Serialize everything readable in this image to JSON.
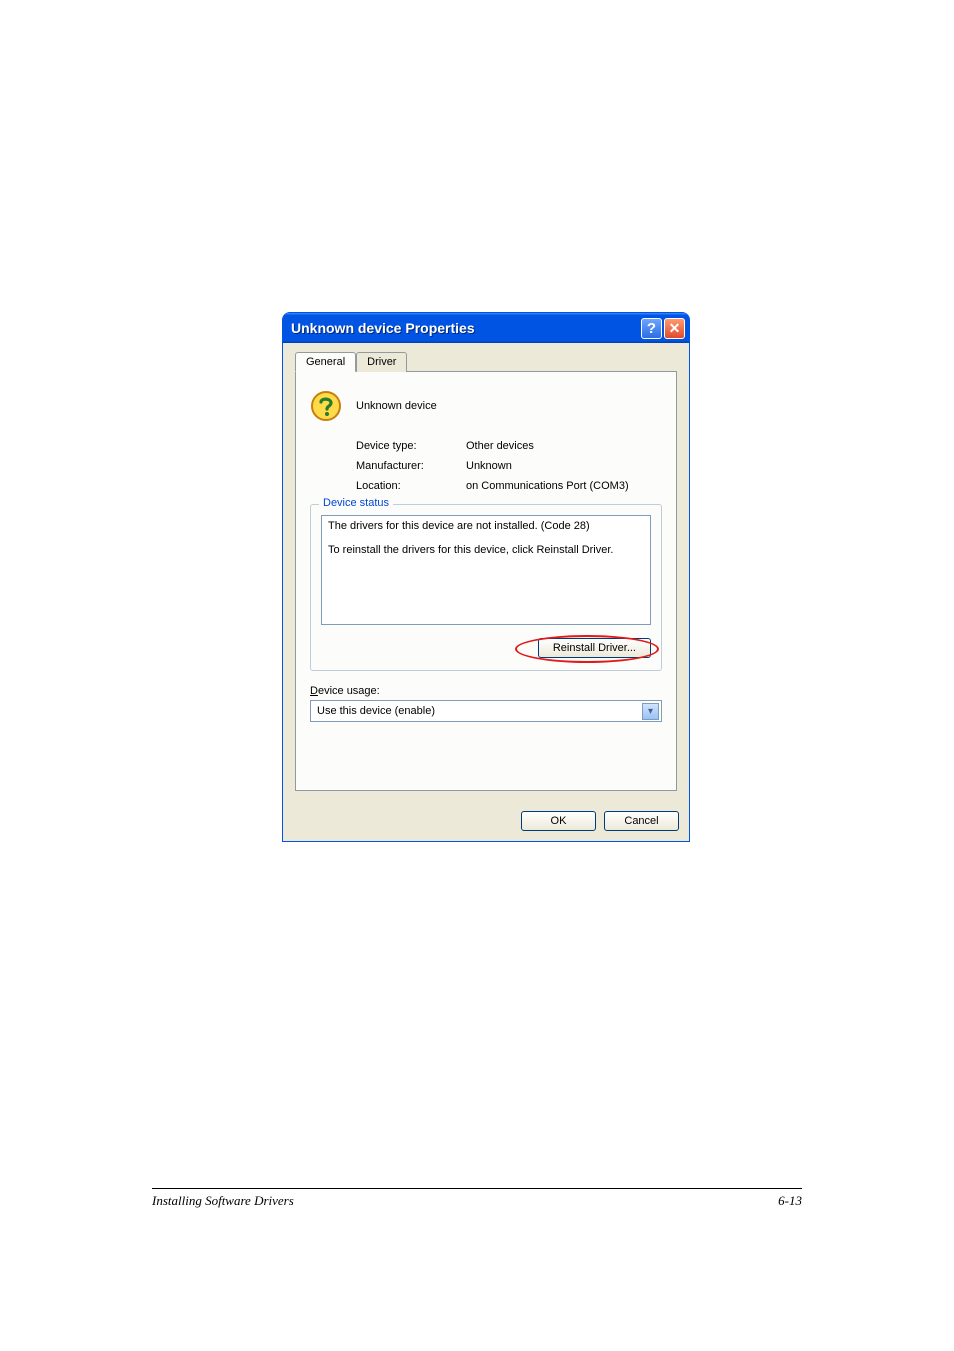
{
  "dialog": {
    "title": "Unknown device Properties",
    "tabs": {
      "general": "General",
      "driver": "Driver"
    },
    "device_name": "Unknown device",
    "props": {
      "type_label": "Device type:",
      "type_value": "Other devices",
      "manufacturer_label": "Manufacturer:",
      "manufacturer_value": "Unknown",
      "location_label": "Location:",
      "location_value": "on Communications Port (COM3)"
    },
    "status": {
      "group_title": "Device status",
      "text": "The drivers for this device are not installed. (Code 28)\n\nTo reinstall the drivers for this device, click Reinstall Driver.",
      "reinstall_label": "Reinstall Driver..."
    },
    "usage": {
      "label_prefix": "D",
      "label_rest": "evice usage:",
      "selected": "Use this device (enable)"
    },
    "buttons": {
      "ok": "OK",
      "cancel": "Cancel"
    }
  },
  "footer": {
    "left": "Installing Software Drivers",
    "right": "6-13"
  }
}
